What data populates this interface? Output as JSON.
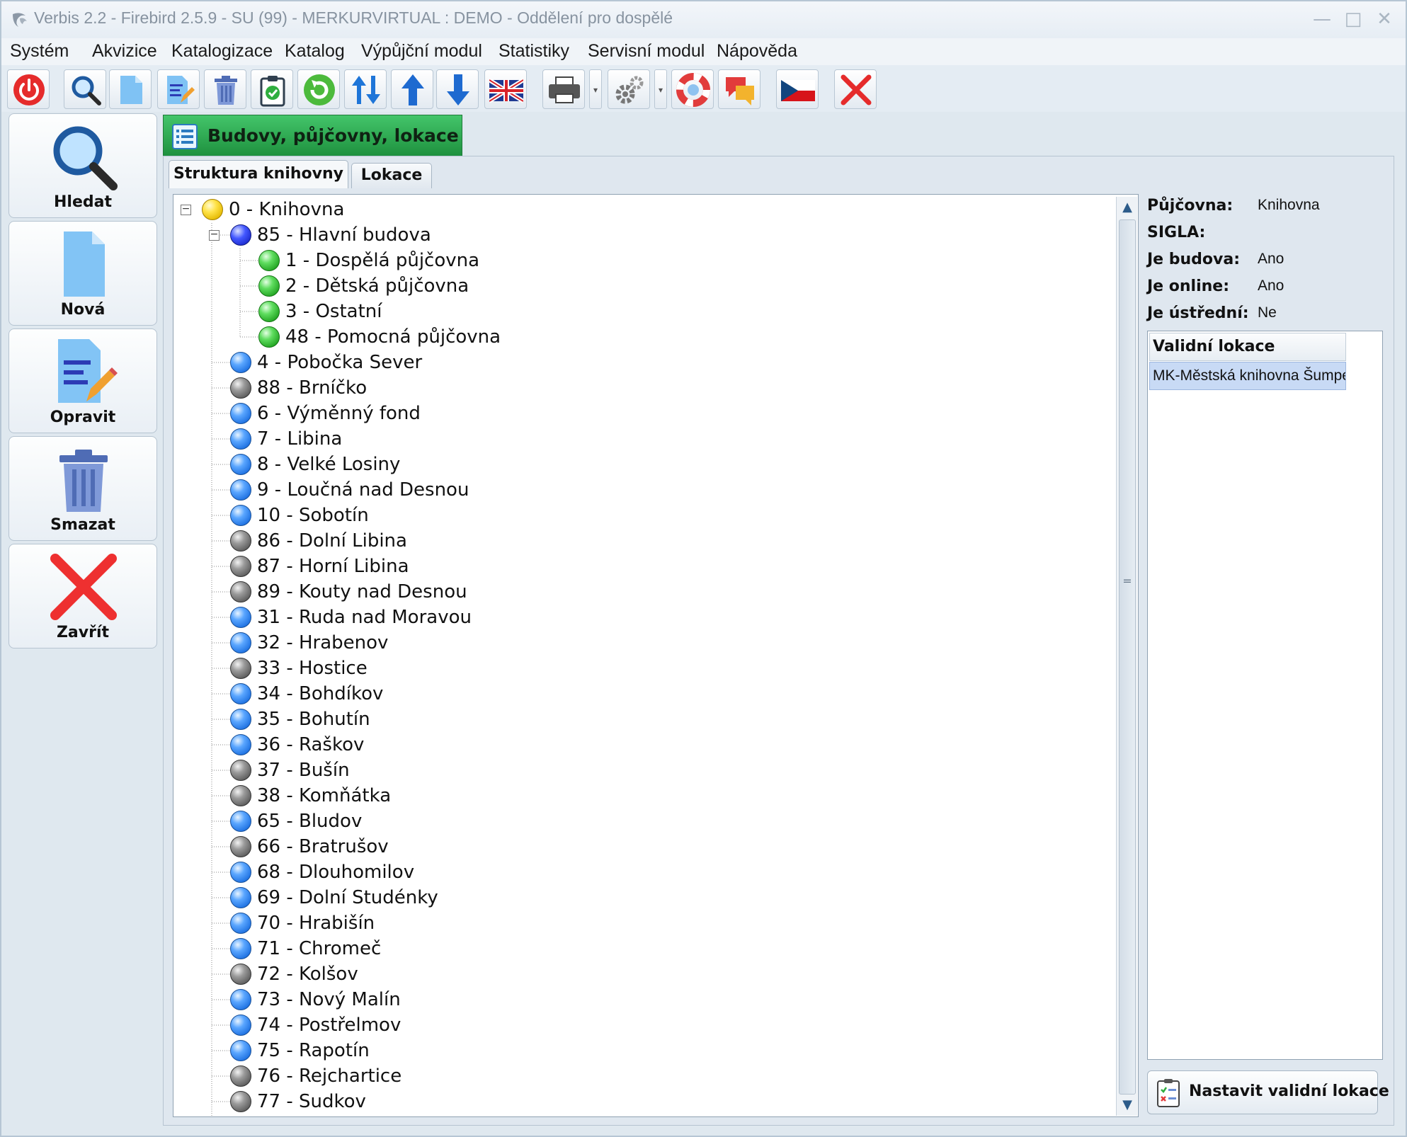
{
  "window": {
    "title": "Verbis 2.2 - Firebird 2.5.9 - SU (99) - MERKURVIRTUAL : DEMO - Oddělení pro dospělé"
  },
  "menu": [
    "Systém",
    "Akvizice",
    "Katalogizace",
    "Katalog",
    "Výpůjční modul",
    "Statistiky",
    "Servisní modul",
    "Nápověda"
  ],
  "sidebar": {
    "search": "Hledat",
    "new": "Nová",
    "edit": "Opravit",
    "delete": "Smazat",
    "close": "Zavřít"
  },
  "main_tab": "Budovy, půjčovny, lokace",
  "subtabs": {
    "structure": "Struktura knihovny",
    "locations": "Lokace"
  },
  "tree": [
    {
      "label": "0 - Knihovna",
      "level": 0,
      "color": "yellow",
      "expanded": true
    },
    {
      "label": "85 - Hlavní budova",
      "level": 1,
      "color": "navy",
      "expanded": true
    },
    {
      "label": "1 - Dospělá půjčovna",
      "level": 2,
      "color": "green"
    },
    {
      "label": "2 - Dětská půjčovna",
      "level": 2,
      "color": "green"
    },
    {
      "label": "3 - Ostatní",
      "level": 2,
      "color": "green"
    },
    {
      "label": "48 - Pomocná půjčovna",
      "level": 2,
      "color": "green"
    },
    {
      "label": "4 - Pobočka Sever",
      "level": 1,
      "color": "blue"
    },
    {
      "label": "88 - Brníčko",
      "level": 1,
      "color": "gray"
    },
    {
      "label": "6 - Výměnný fond",
      "level": 1,
      "color": "blue"
    },
    {
      "label": "7 - Libina",
      "level": 1,
      "color": "blue"
    },
    {
      "label": "8 - Velké Losiny",
      "level": 1,
      "color": "blue"
    },
    {
      "label": "9 - Loučná nad Desnou",
      "level": 1,
      "color": "blue"
    },
    {
      "label": "10 - Sobotín",
      "level": 1,
      "color": "blue"
    },
    {
      "label": "86 - Dolní Libina",
      "level": 1,
      "color": "gray"
    },
    {
      "label": "87 - Horní Libina",
      "level": 1,
      "color": "gray"
    },
    {
      "label": "89 - Kouty nad Desnou",
      "level": 1,
      "color": "gray"
    },
    {
      "label": "31 - Ruda nad Moravou",
      "level": 1,
      "color": "blue"
    },
    {
      "label": "32 - Hrabenov",
      "level": 1,
      "color": "blue"
    },
    {
      "label": "33 - Hostice",
      "level": 1,
      "color": "gray"
    },
    {
      "label": "34 - Bohdíkov",
      "level": 1,
      "color": "blue"
    },
    {
      "label": "35 - Bohutín",
      "level": 1,
      "color": "blue"
    },
    {
      "label": "36 - Raškov",
      "level": 1,
      "color": "blue"
    },
    {
      "label": "37 - Bušín",
      "level": 1,
      "color": "gray"
    },
    {
      "label": "38 - Komňátka",
      "level": 1,
      "color": "gray"
    },
    {
      "label": "65 - Bludov",
      "level": 1,
      "color": "blue"
    },
    {
      "label": "66 - Bratrušov",
      "level": 1,
      "color": "gray"
    },
    {
      "label": "68 - Dlouhomilov",
      "level": 1,
      "color": "blue"
    },
    {
      "label": "69 - Dolní Studénky",
      "level": 1,
      "color": "blue"
    },
    {
      "label": "70 - Hrabišín",
      "level": 1,
      "color": "blue"
    },
    {
      "label": "71 - Chromeč",
      "level": 1,
      "color": "blue"
    },
    {
      "label": "72 - Kolšov",
      "level": 1,
      "color": "gray"
    },
    {
      "label": "73 - Nový Malín",
      "level": 1,
      "color": "blue"
    },
    {
      "label": "74 - Postřelmov",
      "level": 1,
      "color": "blue"
    },
    {
      "label": "75 - Rapotín",
      "level": 1,
      "color": "blue"
    },
    {
      "label": "76 - Rejchartice",
      "level": 1,
      "color": "gray"
    },
    {
      "label": "77 - Sudkov",
      "level": 1,
      "color": "gray"
    }
  ],
  "info": {
    "pujcovna_key": "Půjčovna:",
    "pujcovna_val": "Knihovna",
    "sigla_key": "SIGLA:",
    "sigla_val": "",
    "budova_key": "Je budova:",
    "budova_val": "Ano",
    "online_key": "Je online:",
    "online_val": "Ano",
    "ustredni_key": "Je ústřední:",
    "ustredni_val": "Ne"
  },
  "valid_locations": {
    "header": "Validní lokace",
    "rows": [
      "MK-Městská knihovna Šumpe"
    ]
  },
  "set_valid_button": "Nastavit validní lokace",
  "toolbar_icons": [
    "power-icon",
    "search-icon",
    "new-document-icon",
    "edit-icon",
    "trash-icon",
    "clipboard-check-icon",
    "refresh-icon",
    "sort-icon",
    "arrow-up-icon",
    "arrow-down-icon",
    "uk-flag-icon",
    "printer-icon",
    "gear-icon",
    "lifebuoy-icon",
    "chat-icon",
    "czech-flag-icon",
    "close-icon"
  ]
}
